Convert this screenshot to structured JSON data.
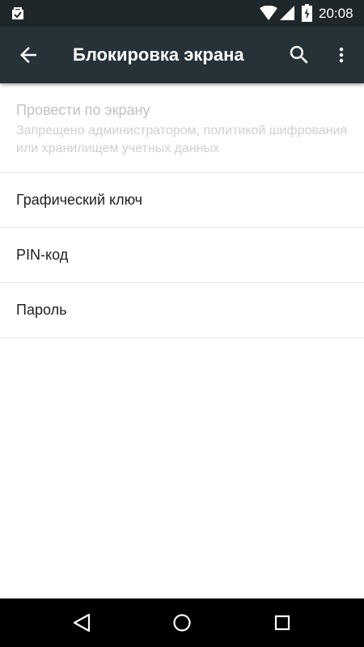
{
  "status_bar": {
    "time": "20:08",
    "icons": [
      "notification-icon",
      "wifi-icon",
      "signal-icon",
      "battery-icon"
    ]
  },
  "app_bar": {
    "title": "Блокировка экрана",
    "icons": [
      "back-arrow-icon",
      "search-icon",
      "more-vert-icon"
    ]
  },
  "list": {
    "items": [
      {
        "title": "Провести по экрану",
        "summary": "Запрещено администратором, политикой шифрования или хранилищем учетных данных",
        "enabled": false
      },
      {
        "title": "Графический ключ",
        "enabled": true
      },
      {
        "title": "PIN-код",
        "enabled": true
      },
      {
        "title": "Пароль",
        "enabled": true
      }
    ]
  },
  "nav_bar": {
    "icons": [
      "nav-back-icon",
      "nav-home-icon",
      "nav-recents-icon"
    ]
  },
  "colors": {
    "status_bar": "#1f272b",
    "app_bar": "#263238",
    "background": "#ffffff",
    "text_primary": "#212121",
    "text_disabled": "#c2c2c2",
    "divider": "#e2e2e2",
    "nav_bar": "#000000"
  }
}
